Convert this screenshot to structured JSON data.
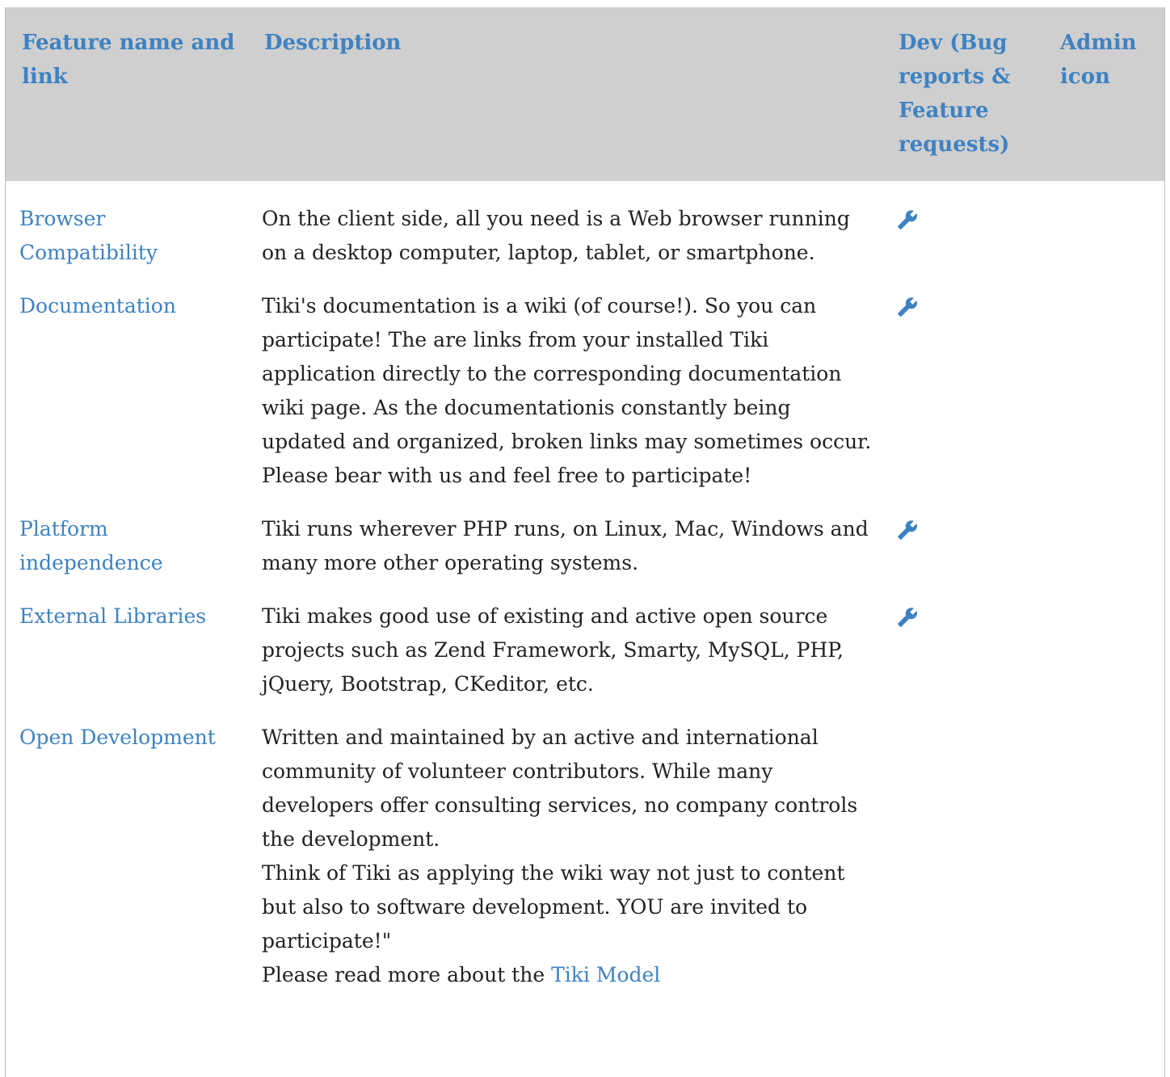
{
  "table": {
    "headers": {
      "feature": "Feature name and link",
      "description": "Description",
      "dev": "Dev (Bug reports & Feature requests)",
      "admin": "Admin icon"
    },
    "rows": [
      {
        "feature": "Browser Compatibility",
        "description": "On the client side, all you need is a Web browser running on a desktop computer, laptop, tablet, or smartphone.",
        "dev_icon": "wrench-icon"
      },
      {
        "feature": "Documentation",
        "description": "Tiki's documentation is a wiki (of course!). So you can participate! The are links from your installed Tiki application directly to the corresponding documentation wiki page. As the documentationis constantly being updated and organized, broken links may sometimes occur. Please bear with us and feel free to participate!",
        "dev_icon": "wrench-icon"
      },
      {
        "feature": "Platform independence",
        "description": "Tiki runs wherever PHP runs, on Linux, Mac, Windows and many more other operating systems.",
        "dev_icon": "wrench-icon"
      },
      {
        "feature": "External Libraries",
        "description": "Tiki makes good use of existing and active open source projects such as Zend Framework, Smarty, MySQL, PHP, jQuery, Bootstrap, CKeditor, etc.",
        "dev_icon": "wrench-icon"
      },
      {
        "feature": "Open Development",
        "description_lines": [
          "Written and maintained by an active and international community of volunteer contributors. While many developers offer consulting services, no company controls the development.",
          "Think of Tiki as applying the wiki way not just to content but also to software development. YOU are invited to participate!\""
        ],
        "read_more_prefix": "Please read more about the ",
        "read_more_link": "Tiki Model"
      }
    ]
  },
  "colors": {
    "link": "#3e82c2",
    "header_bg": "#cfcfcf",
    "text": "#222222"
  }
}
